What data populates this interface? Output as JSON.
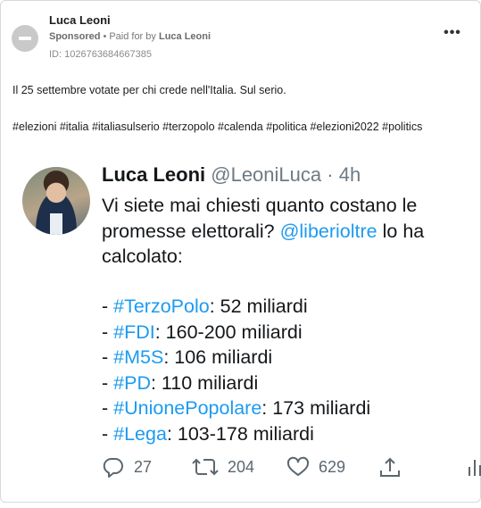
{
  "ad": {
    "author": "Luca Leoni",
    "sponsored_label": "Sponsored",
    "paid_prefix": "Paid for by",
    "payer": "Luca Leoni",
    "ad_id": "ID: 1026763684667385",
    "more_label": "•••",
    "caption": "Il 25 settembre votate per chi crede nell'Italia. Sul serio.",
    "hashtags": "#elezioni #italia #italiasulserio #terzopolo #calenda #politica #elezioni2022 #politics"
  },
  "tweet": {
    "name": "Luca Leoni",
    "handle": "@LeoniLuca",
    "separator": "·",
    "time": "4h",
    "body_before_mention": "Vi siete mai chiesti quanto costano le promesse elettorali? ",
    "mention": "@liberioltre",
    "body_after_mention": " lo ha calcolato:",
    "list": [
      {
        "prefix": "- ",
        "tag": "#TerzoPolo",
        "value": ": 52 miliardi"
      },
      {
        "prefix": "- ",
        "tag": "#FDI",
        "value": ": 160-200 miliardi"
      },
      {
        "prefix": "- ",
        "tag": "#M5S",
        "value": ": 106 miliardi"
      },
      {
        "prefix": "- ",
        "tag": "#PD",
        "value": ": 110 miliardi"
      },
      {
        "prefix": "- ",
        "tag": "#UnionePopolare",
        "value": ": 173 miliardi"
      },
      {
        "prefix": "- ",
        "tag": "#Lega",
        "value": ": 103-178 miliardi"
      }
    ],
    "actions": {
      "replies": "27",
      "retweets": "204",
      "likes": "629"
    },
    "link_color": "#1d9bf0"
  }
}
